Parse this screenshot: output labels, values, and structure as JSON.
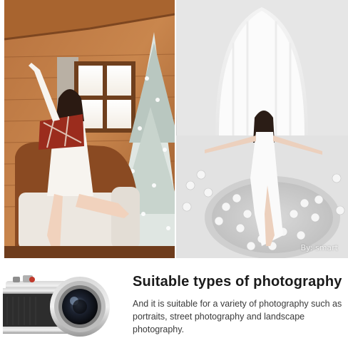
{
  "watermark": {
    "credit": "By:  smart"
  },
  "feature": {
    "title": "Suitable types of photography",
    "description": "And it is suitable for a variety of photography such as portraits, street photography and landscape photography."
  }
}
